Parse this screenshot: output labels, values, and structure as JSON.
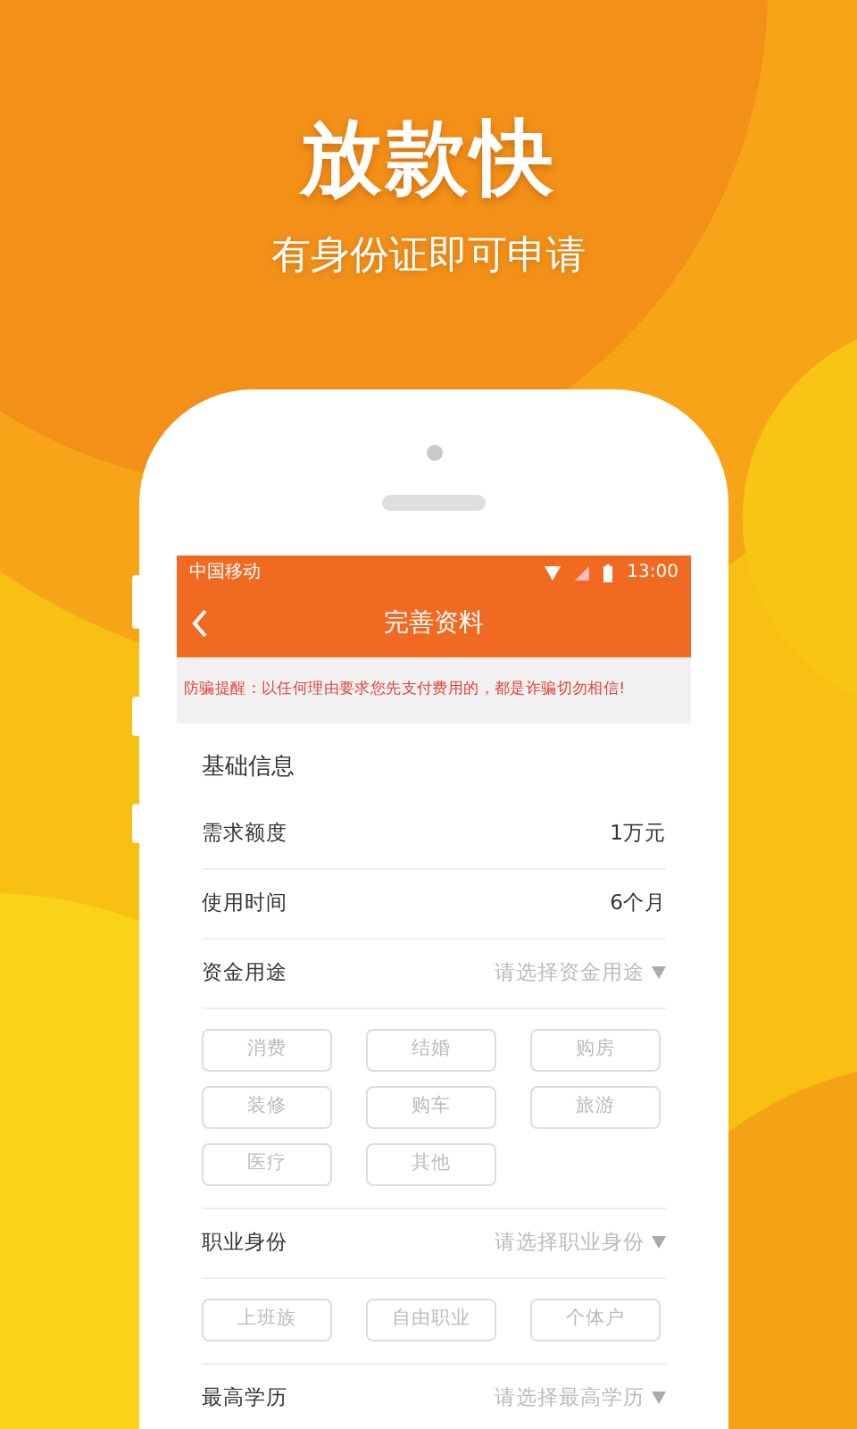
{
  "headline": "放款快",
  "subtitle": "有身份证即可申请",
  "status_bar": {
    "carrier": "中国移动",
    "time": "13:00"
  },
  "nav": {
    "title": "完善资料"
  },
  "notice": "防骗提醒：以任何理由要求您先支付费用的，都是诈骗切勿相信!",
  "section_title": "基础信息",
  "fields": [
    {
      "kind": "value",
      "label": "需求额度",
      "value": "1万元"
    },
    {
      "kind": "value",
      "label": "使用时间",
      "value": "6个月"
    },
    {
      "kind": "select",
      "label": "资金用途",
      "placeholder": "请选择资金用途",
      "options": [
        {
          "label": "消费",
          "selected": false
        },
        {
          "label": "结婚",
          "selected": false
        },
        {
          "label": "购房",
          "selected": false
        },
        {
          "label": "装修",
          "selected": false
        },
        {
          "label": "购车",
          "selected": false
        },
        {
          "label": "旅游",
          "selected": false
        },
        {
          "label": "医疗",
          "selected": false
        },
        {
          "label": "其他",
          "selected": false
        }
      ]
    },
    {
      "kind": "select",
      "label": "职业身份",
      "placeholder": "请选择职业身份",
      "options": [
        {
          "label": "上班族",
          "selected": false
        },
        {
          "label": "自由职业",
          "selected": false
        },
        {
          "label": "个体户",
          "selected": false
        }
      ]
    },
    {
      "kind": "select",
      "label": "最高学历",
      "placeholder": "请选择最高学历"
    }
  ]
}
